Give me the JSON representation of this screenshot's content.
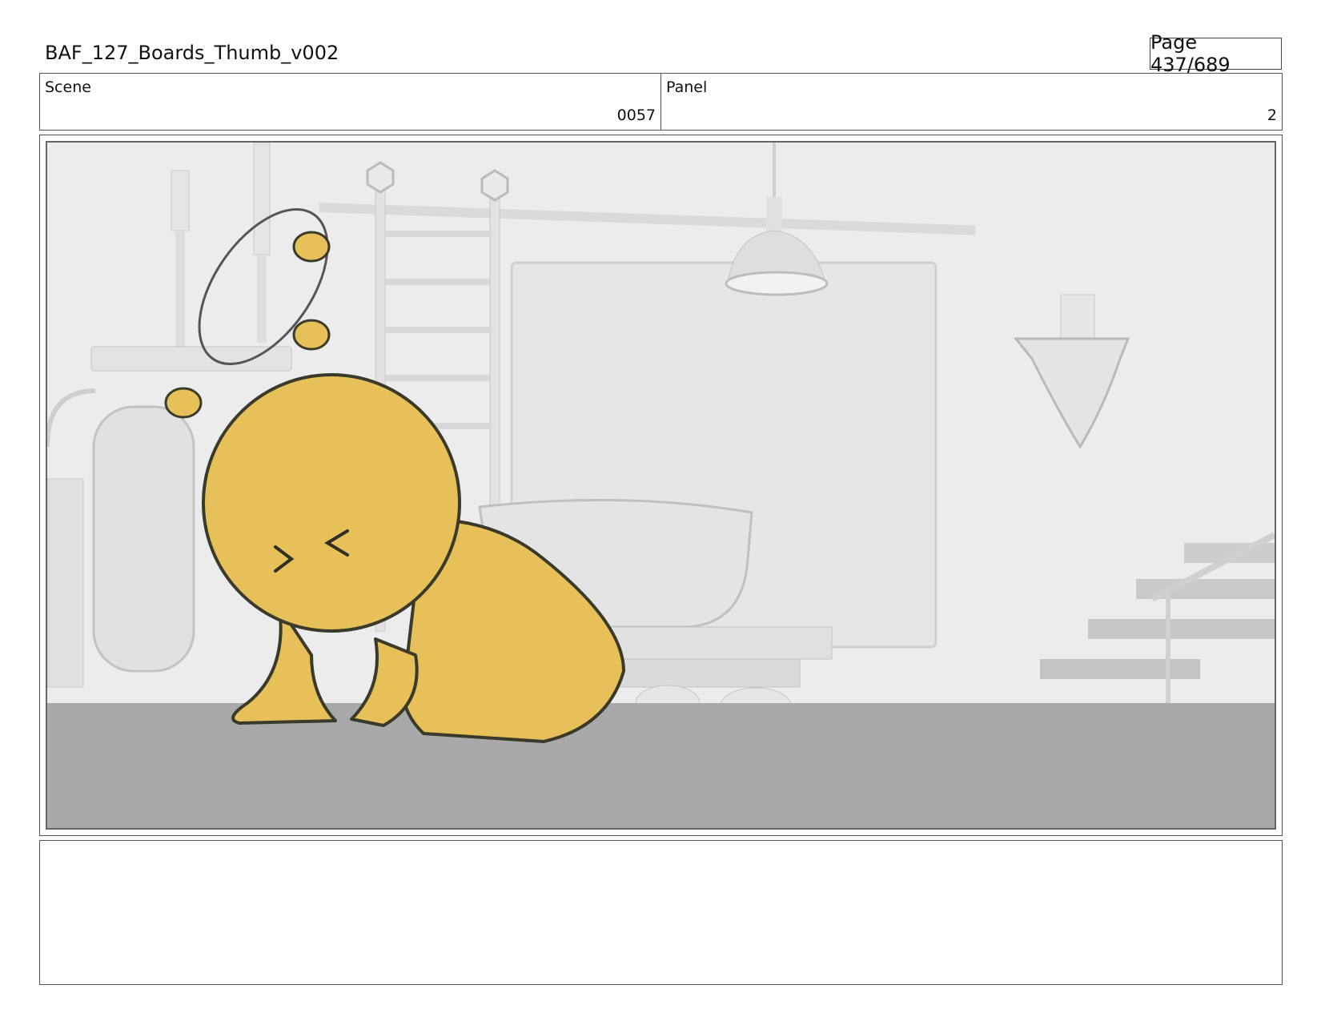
{
  "header": {
    "title": "BAF_127_Boards_Thumb_v002",
    "page_label": "Page 437/689"
  },
  "info": {
    "scene_label": "Scene",
    "scene_value": "0057",
    "panel_label": "Panel",
    "panel_value": "2"
  },
  "panel": {
    "image_name": "storyboard-panel-drawing"
  },
  "notes": {
    "text": ""
  }
}
